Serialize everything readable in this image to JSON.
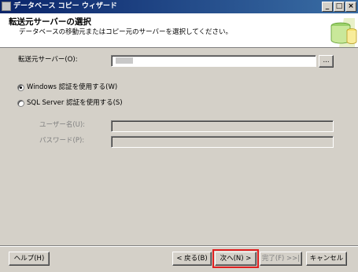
{
  "window": {
    "title": "データベース コピー ウィザード"
  },
  "titlebar_buttons": {
    "minimize": "_",
    "maximize": "□",
    "close": "×"
  },
  "header": {
    "title": "転送元サーバーの選択",
    "subtitle": "データベースの移動元またはコピー元のサーバーを選択してください。",
    "graphic_icon": "database-icon"
  },
  "source_server": {
    "label": "転送元サーバー(O):",
    "value": "",
    "browse_label": "..."
  },
  "auth": {
    "windows_label": "Windows 認証を使用する(W)",
    "sql_label": "SQL Server 認証を使用する(S)",
    "selected": "windows",
    "username_label": "ユーザー名(U):",
    "password_label": "パスワード(P):"
  },
  "footer": {
    "help": "ヘルプ(H)",
    "back": "< 戻る(B)",
    "next": "次へ(N) >",
    "finish": "完了(F) >>|",
    "cancel": "キャンセル"
  },
  "colors": {
    "accent": "#0a246a",
    "focus_outline": "#e02020",
    "face": "#d4d0c8"
  }
}
